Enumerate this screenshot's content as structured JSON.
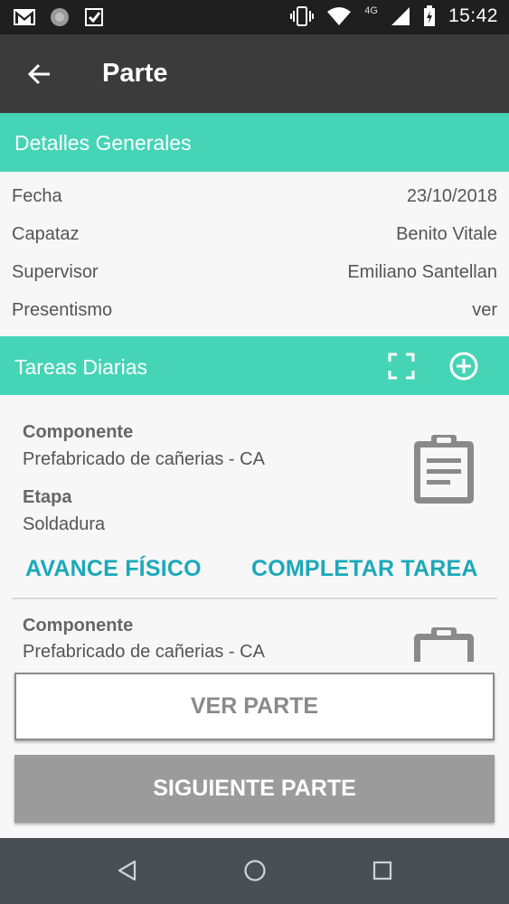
{
  "status_bar": {
    "time": "15:42",
    "network": "4G",
    "icons": [
      "gmail-icon",
      "sync-icon",
      "play-icon",
      "vibrate-icon",
      "wifi-icon",
      "signal-icon",
      "battery-charging-icon"
    ]
  },
  "app_bar": {
    "title": "Parte",
    "back_icon": "arrow-back-icon"
  },
  "general": {
    "header": "Detalles Generales",
    "rows": [
      {
        "label": "Fecha",
        "value": "23/10/2018"
      },
      {
        "label": "Capataz",
        "value": "Benito Vitale"
      },
      {
        "label": "Supervisor",
        "value": "Emiliano Santellan"
      },
      {
        "label": "Presentismo",
        "value": "ver"
      }
    ]
  },
  "tasks": {
    "header": "Tareas Diarias",
    "icons": [
      "fullscreen-icon",
      "add-circle-icon"
    ],
    "items": [
      {
        "component_label": "Componente",
        "component_value": "Prefabricado de cañerias - CA",
        "stage_label": "Etapa",
        "stage_value": "Soldadura",
        "action_progress": "AVANCE FÍSICO",
        "action_complete": "COMPLETAR TAREA"
      },
      {
        "component_label": "Componente",
        "component_value": "Prefabricado de cañerias - CA"
      }
    ]
  },
  "buttons": {
    "view": "VER PARTE",
    "next": "SIGUIENTE PARTE"
  },
  "nav_bar": {
    "icons": [
      "back-triangle-icon",
      "home-circle-icon",
      "recents-square-icon"
    ]
  },
  "colors": {
    "accent": "#46d4b6",
    "action": "#1ba9ba",
    "app_bar": "#3b3b3b",
    "status_bar": "#1f1f1f"
  }
}
